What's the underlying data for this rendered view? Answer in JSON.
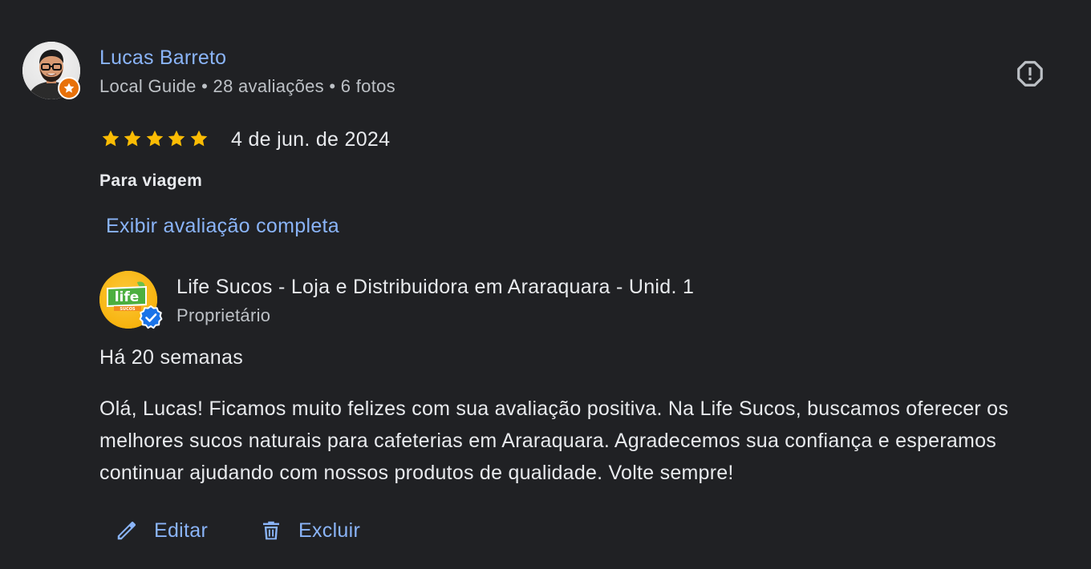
{
  "review": {
    "author": {
      "name": "Lucas Barreto",
      "meta": "Local Guide • 28 avaliações • 6 fotos",
      "avatar_icon": "person-avatar",
      "badge_icon": "local-guide-star-icon"
    },
    "rating": {
      "stars": 5,
      "max": 5,
      "star_color": "#fbbc04"
    },
    "date": "4 de jun. de 2024",
    "service_type": "Para viagem",
    "show_full_label": "Exibir avaliação completa",
    "report_icon": "report-flag-icon"
  },
  "owner_reply": {
    "business_name": "Life Sucos - Loja e Distribuidora em Araraquara - Unid. 1",
    "role": "Proprietário",
    "logo_text": "life",
    "logo_subtext": "SUCOS",
    "verified_icon": "verified-badge-icon",
    "time_ago": "Há 20 semanas",
    "text": "Olá, Lucas! Ficamos muito felizes com sua avaliação positiva. Na Life Sucos, buscamos oferecer os melhores sucos naturais para cafeterias em Araraquara. Agradecemos sua confiança e esperamos continuar ajudando com nossos produtos de qualidade. Volte sempre!"
  },
  "actions": {
    "edit_label": "Editar",
    "delete_label": "Excluir",
    "edit_icon": "pencil-icon",
    "delete_icon": "trash-icon"
  },
  "colors": {
    "background": "#202124",
    "link": "#8ab4f8",
    "text_primary": "#e8eaed",
    "text_secondary": "#bdc1c6",
    "star": "#fbbc04",
    "local_guide_badge": "#e8710a",
    "verified_badge": "#1a73e8"
  }
}
